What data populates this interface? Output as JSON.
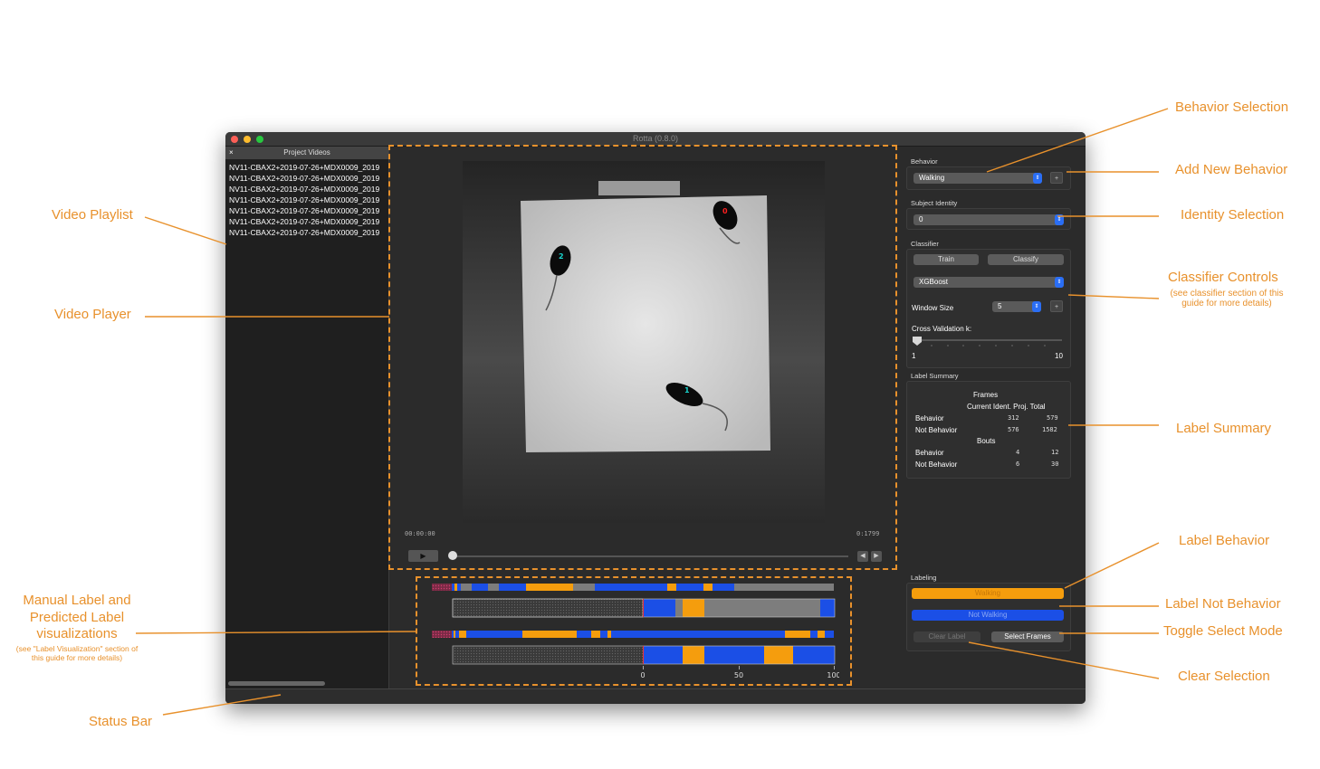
{
  "window": {
    "title": "Rotta (0.8.0)",
    "traffic_colors": [
      "#fc5f57",
      "#fdbc2e",
      "#28c840"
    ]
  },
  "sidebar": {
    "header": "Project Videos",
    "close_label": "×",
    "videos": [
      "NV11-CBAX2+2019-07-26+MDX0009_2019",
      "NV11-CBAX2+2019-07-26+MDX0009_2019",
      "NV11-CBAX2+2019-07-26+MDX0009_2019",
      "NV11-CBAX2+2019-07-26+MDX0009_2019",
      "NV11-CBAX2+2019-07-26+MDX0009_2019",
      "NV11-CBAX2+2019-07-26+MDX0009_2019",
      "NV11-CBAX2+2019-07-26+MDX0009_2019"
    ]
  },
  "player": {
    "time_current": "00:00:00",
    "time_end": "0:1799",
    "play_icon": "play-icon",
    "prev_icon": "step-back-icon",
    "next_icon": "step-forward-icon",
    "subject_labels": [
      "0",
      "2",
      "1"
    ],
    "subject_colors": [
      "#ff2020",
      "#19d6cf",
      "#19d6cf"
    ]
  },
  "timeline": {
    "axis_ticks": [
      "0",
      "50",
      "100"
    ],
    "colors": {
      "behavior": "#f59d0d",
      "not_behavior": "#1b4fe6",
      "unlabeled": "#7d7d7d",
      "empty": "#3a3a3a"
    }
  },
  "right": {
    "behavior": {
      "label": "Behavior",
      "value": "Walking",
      "add_label": "+"
    },
    "identity": {
      "label": "Subject Identity",
      "value": "0"
    },
    "classifier": {
      "label": "Classifier",
      "train": "Train",
      "classify": "Classify",
      "model": "XGBoost",
      "window_size_label": "Window Size",
      "window_size_value": "5",
      "window_add": "+",
      "cv_label": "Cross Validation k:",
      "cv_min": "1",
      "cv_max": "10",
      "cv_value": 1
    },
    "summary": {
      "label": "Label Summary",
      "frames_header": "Frames",
      "col_headers": "Current Ident. Proj. Total",
      "bouts_header": "Bouts",
      "frames_rows": [
        {
          "name": "Behavior",
          "current": "312",
          "total": "579"
        },
        {
          "name": "Not Behavior",
          "current": "576",
          "total": "1582"
        }
      ],
      "bouts_rows": [
        {
          "name": "Behavior",
          "current": "4",
          "total": "12"
        },
        {
          "name": "Not Behavior",
          "current": "6",
          "total": "30"
        }
      ]
    },
    "labeling": {
      "label": "Labeling",
      "behavior_btn": "Walking",
      "not_behavior_btn": "Not Walking",
      "clear_btn": "Clear Label",
      "select_btn": "Select Frames"
    }
  },
  "annotations": {
    "behavior_selection": "Behavior Selection",
    "add_new_behavior": "Add New Behavior",
    "identity_selection": "Identity Selection",
    "classifier_controls": "Classifier Controls",
    "classifier_sub": "(see classifier section of this guide for more details)",
    "label_summary": "Label Summary",
    "label_behavior": "Label Behavior",
    "label_not_behavior": "Label Not Behavior",
    "toggle_select": "Toggle Select Mode",
    "clear_selection": "Clear Selection",
    "video_playlist": "Video Playlist",
    "video_player": "Video Player",
    "manual_label_l1": "Manual Label and",
    "manual_label_l2": "Predicted Label",
    "manual_label_l3": "visualizations",
    "manual_label_sub": "(see \"Label Visualization\" section of this guide for more details)",
    "status_bar": "Status Bar",
    "color": "#e8912c"
  }
}
